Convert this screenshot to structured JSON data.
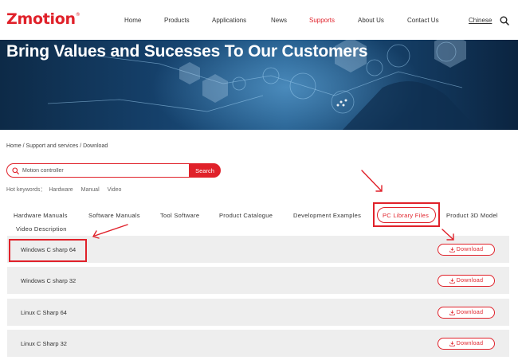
{
  "header": {
    "logo": "Zmotion",
    "logo_mark": "®",
    "nav": [
      {
        "label": "Home",
        "active": false
      },
      {
        "label": "Products",
        "active": false
      },
      {
        "label": "Applications",
        "active": false
      },
      {
        "label": "News",
        "active": false
      },
      {
        "label": "Supports",
        "active": true
      },
      {
        "label": "About Us",
        "active": false
      },
      {
        "label": "Contact Us",
        "active": false
      }
    ],
    "language": "Chinese"
  },
  "banner": {
    "title": "Bring Values and Sucesses To Our Customers"
  },
  "breadcrumb": "Home / Support and services / Download",
  "search": {
    "value": "Motion controller",
    "button": "Search"
  },
  "hot_keywords": {
    "label": "Hot keywords：",
    "items": [
      "Hardware",
      "Manual",
      "Video"
    ]
  },
  "tabs": [
    {
      "label": "Hardware Manuals",
      "active": false
    },
    {
      "label": "Software Manuals",
      "active": false
    },
    {
      "label": "Tool Software",
      "active": false
    },
    {
      "label": "Product Catalogue",
      "active": false
    },
    {
      "label": "Development Examples",
      "active": false
    },
    {
      "label": "PC Library Files",
      "active": true
    },
    {
      "label": "Product 3D Model",
      "active": false
    },
    {
      "label": "Video Description",
      "active": false
    }
  ],
  "downloads": [
    {
      "name": "Windows C sharp 64",
      "button": "Download"
    },
    {
      "name": "Windows C sharp 32",
      "button": "Download"
    },
    {
      "name": "Linux C Sharp 64",
      "button": "Download"
    },
    {
      "name": "Linux C Sharp 32",
      "button": "Download"
    }
  ],
  "colors": {
    "accent": "#e0212a",
    "row_bg": "#eeeeee",
    "banner": "#15406a"
  },
  "icons": [
    "search-icon",
    "download-icon",
    "arrow-annotation"
  ]
}
